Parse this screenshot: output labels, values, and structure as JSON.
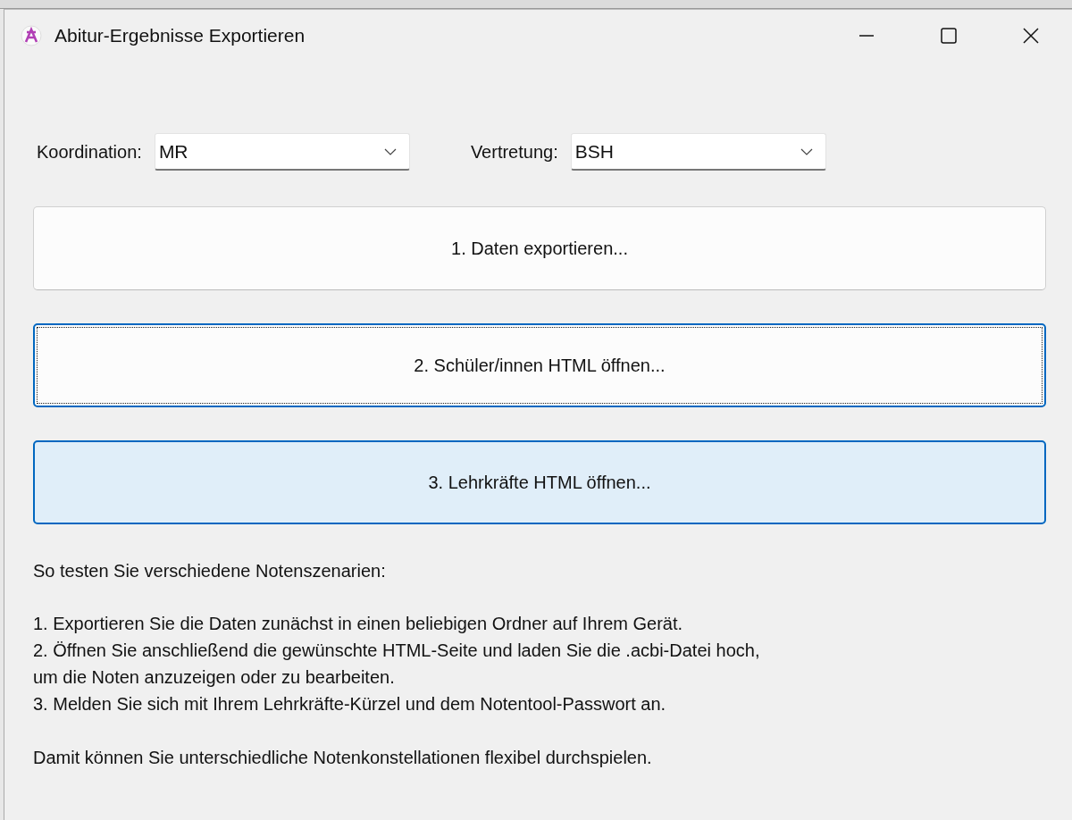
{
  "window": {
    "title": "Abitur-Ergebnisse Exportieren"
  },
  "selectors": [
    {
      "label": "Koordination:",
      "value": "MR"
    },
    {
      "label": "Vertretung:",
      "value": "BSH"
    }
  ],
  "buttons": [
    {
      "label": "1. Daten exportieren...",
      "focused": false,
      "hovered": false
    },
    {
      "label": "2. Schüler/innen HTML öffnen...",
      "focused": true,
      "hovered": false
    },
    {
      "label": "3. Lehrkräfte HTML öffnen...",
      "focused": false,
      "hovered": true
    }
  ],
  "instructions": {
    "intro": "So testen Sie verschiedene Notenszenarien:",
    "steps": [
      "1. Exportieren Sie die Daten zunächst in einen beliebigen Ordner auf Ihrem Gerät.",
      "2. Öffnen Sie anschließend die gewünschte HTML-Seite und laden Sie die .acbi-Datei hoch,",
      "um die Noten anzuzeigen oder zu bearbeiten.",
      "3. Melden Sie sich mit Ihrem Lehrkräfte-Kürzel und dem Notentool-Passwort an."
    ],
    "closing": "Damit können Sie unterschiedliche Notenkonstellationen flexibel durchspielen."
  }
}
